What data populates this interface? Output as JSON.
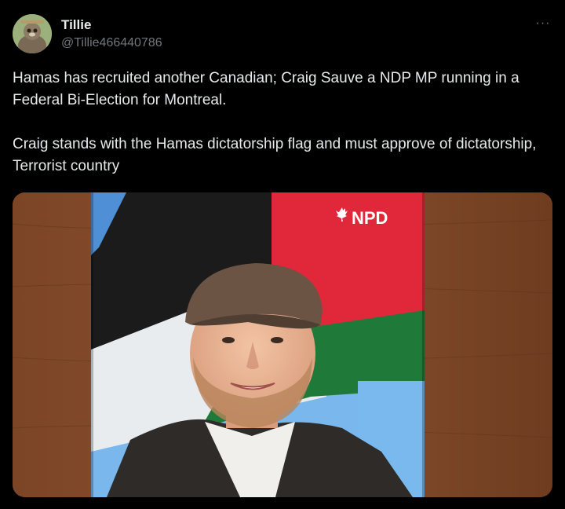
{
  "author": {
    "name": "Tillie",
    "handle": "@Tillie466440786"
  },
  "more_menu": "···",
  "tweet": {
    "paragraphs": [
      "Hamas has recruited another Canadian; Craig Sauve a NDP MP running in a Federal Bi-Election for Montreal.",
      "Craig stands with the Hamas dictatorship flag and must approve of dictatorship, Terrorist country"
    ]
  },
  "media": {
    "poster_logo": "NPD",
    "colors": {
      "flag_red": "#e0283a",
      "flag_green": "#1f7a3a",
      "flag_black": "#1a1a1a",
      "flag_white": "#e9ecef",
      "sky_blue": "#6aaee8",
      "wood": "#7a4325",
      "cap": "#6b5444",
      "jacket": "#2e2b29"
    }
  }
}
